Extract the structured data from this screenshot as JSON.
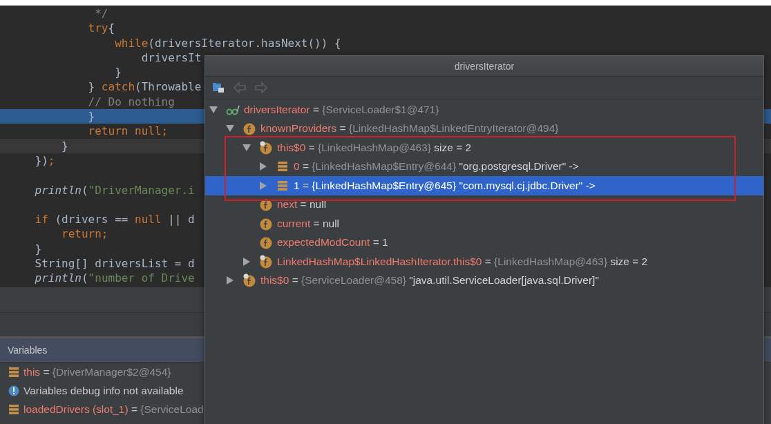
{
  "editor": {
    "lines": [
      {
        "kind": "code",
        "tokens": [
          {
            "t": "             */",
            "kind": "comment"
          }
        ],
        "current": false,
        "caret": false
      },
      {
        "kind": "code",
        "tokens": [
          {
            "t": "            try",
            "kind": "keyword"
          },
          {
            "t": "{",
            "kind": "plain"
          }
        ],
        "current": false,
        "caret": false
      },
      {
        "kind": "code",
        "tokens": [
          {
            "t": "                while",
            "kind": "keyword"
          },
          {
            "t": "(driversIterator.hasNext()) {",
            "kind": "plain"
          }
        ],
        "current": false,
        "caret": false
      },
      {
        "kind": "code",
        "tokens": [
          {
            "t": "                    driversIt",
            "kind": "plain"
          }
        ],
        "current": false,
        "caret": false
      },
      {
        "kind": "code",
        "tokens": [
          {
            "t": "                }",
            "kind": "plain"
          }
        ],
        "current": false,
        "caret": false
      },
      {
        "kind": "code",
        "tokens": [
          {
            "t": "            } ",
            "kind": "plain"
          },
          {
            "t": "catch",
            "kind": "keyword"
          },
          {
            "t": "(Throwable",
            "kind": "plain"
          }
        ],
        "current": false,
        "caret": false
      },
      {
        "kind": "code",
        "tokens": [
          {
            "t": "            // Do nothing",
            "kind": "comment"
          }
        ],
        "current": false,
        "caret": false
      },
      {
        "kind": "code",
        "tokens": [
          {
            "t": "            }",
            "kind": "plain"
          }
        ],
        "current": true,
        "caret": false
      },
      {
        "kind": "code",
        "tokens": [
          {
            "t": "            return null;",
            "kind": "keyword"
          }
        ],
        "current": false,
        "caret": false
      },
      {
        "kind": "code",
        "tokens": [
          {
            "t": "        }",
            "kind": "plain"
          }
        ],
        "current": false,
        "caret": true
      },
      {
        "kind": "code",
        "tokens": [
          {
            "t": "    })",
            "kind": "plain"
          },
          {
            "t": ";",
            "kind": "keyword"
          }
        ],
        "current": false,
        "caret": false
      },
      {
        "kind": "blank"
      },
      {
        "kind": "code",
        "tokens": [
          {
            "t": "    println",
            "kind": "call"
          },
          {
            "t": "(",
            "kind": "plain"
          },
          {
            "t": "\"DriverManager.i",
            "kind": "string"
          }
        ],
        "current": false,
        "caret": false
      },
      {
        "kind": "blank"
      },
      {
        "kind": "code",
        "tokens": [
          {
            "t": "    if",
            "kind": "keyword"
          },
          {
            "t": " (drivers == ",
            "kind": "plain"
          },
          {
            "t": "null",
            "kind": "keyword"
          },
          {
            "t": " || d",
            "kind": "plain"
          }
        ],
        "current": false,
        "caret": false
      },
      {
        "kind": "code",
        "tokens": [
          {
            "t": "        return;",
            "kind": "keyword"
          }
        ],
        "current": false,
        "caret": false
      },
      {
        "kind": "code",
        "tokens": [
          {
            "t": "    }",
            "kind": "plain"
          }
        ],
        "current": false,
        "caret": false
      },
      {
        "kind": "code",
        "tokens": [
          {
            "t": "    String[] driversList = d",
            "kind": "plain"
          }
        ],
        "current": false,
        "caret": false
      },
      {
        "kind": "code",
        "tokens": [
          {
            "t": "    println",
            "kind": "call"
          },
          {
            "t": "(",
            "kind": "plain"
          },
          {
            "t": "\"number of Drive",
            "kind": "string"
          }
        ],
        "current": false,
        "caret": false
      }
    ]
  },
  "variables": {
    "title": "Variables",
    "items": [
      {
        "kind": "entry",
        "name": "this",
        "operator": "=",
        "ref": "{DriverManager$2@454}"
      },
      {
        "kind": "info",
        "text": "Variables debug info not available"
      },
      {
        "kind": "entry",
        "name": "loadedDrivers (slot_1)",
        "operator": "=",
        "ref": "{ServiceLoad"
      }
    ]
  },
  "popup": {
    "title": "driversIterator",
    "toolbar": [
      {
        "kind": "view",
        "disabled": false
      },
      {
        "kind": "back",
        "disabled": true
      },
      {
        "kind": "forward",
        "disabled": true
      }
    ],
    "tree": [
      {
        "kind": "watch",
        "name": "driversIterator",
        "operator": "=",
        "ref": "{ServiceLoader$1@471}",
        "expandable": true,
        "expanded": true,
        "selected": false,
        "children": [
          {
            "kind": "field",
            "name": "knownProviders",
            "operator": "=",
            "ref": "{LinkedHashMap$LinkedEntryIterator@494}",
            "expandable": true,
            "expanded": true,
            "selected": false,
            "children": [
              {
                "kind": "synthetic-field",
                "name": "this$0",
                "operator": "=",
                "ref": "{LinkedHashMap@463}",
                "value": "size = 2",
                "expandable": true,
                "expanded": true,
                "selected": false,
                "children": [
                  {
                    "kind": "entry",
                    "name": "0",
                    "operator": "=",
                    "ref": "{LinkedHashMap$Entry@644}",
                    "value": "\"org.postgresql.Driver\" ->",
                    "expandable": true,
                    "expanded": false,
                    "selected": false
                  },
                  {
                    "kind": "entry",
                    "name": "1",
                    "operator": "=",
                    "ref": "{LinkedHashMap$Entry@645}",
                    "value": "\"com.mysql.cj.jdbc.Driver\" ->",
                    "expandable": true,
                    "expanded": false,
                    "selected": true
                  }
                ]
              },
              {
                "kind": "field",
                "name": "next",
                "operator": "=",
                "value": "null",
                "expandable": false,
                "expanded": false,
                "selected": false
              },
              {
                "kind": "field",
                "name": "current",
                "operator": "=",
                "value": "null",
                "expandable": false,
                "expanded": false,
                "selected": false
              },
              {
                "kind": "field",
                "name": "expectedModCount",
                "operator": "=",
                "value": "1",
                "expandable": false,
                "expanded": false,
                "selected": false
              },
              {
                "kind": "synthetic-field",
                "name": "LinkedHashMap$LinkedHashIterator.this$0",
                "operator": "=",
                "ref": "{LinkedHashMap@463}",
                "value": "size = 2",
                "expandable": true,
                "expanded": false,
                "selected": false
              }
            ]
          },
          {
            "kind": "synthetic-field",
            "name": "this$0",
            "operator": "=",
            "ref": "{ServiceLoader@458}",
            "value": "\"java.util.ServiceLoader[java.sql.Driver]\"",
            "expandable": true,
            "expanded": false,
            "selected": false
          }
        ]
      }
    ]
  }
}
